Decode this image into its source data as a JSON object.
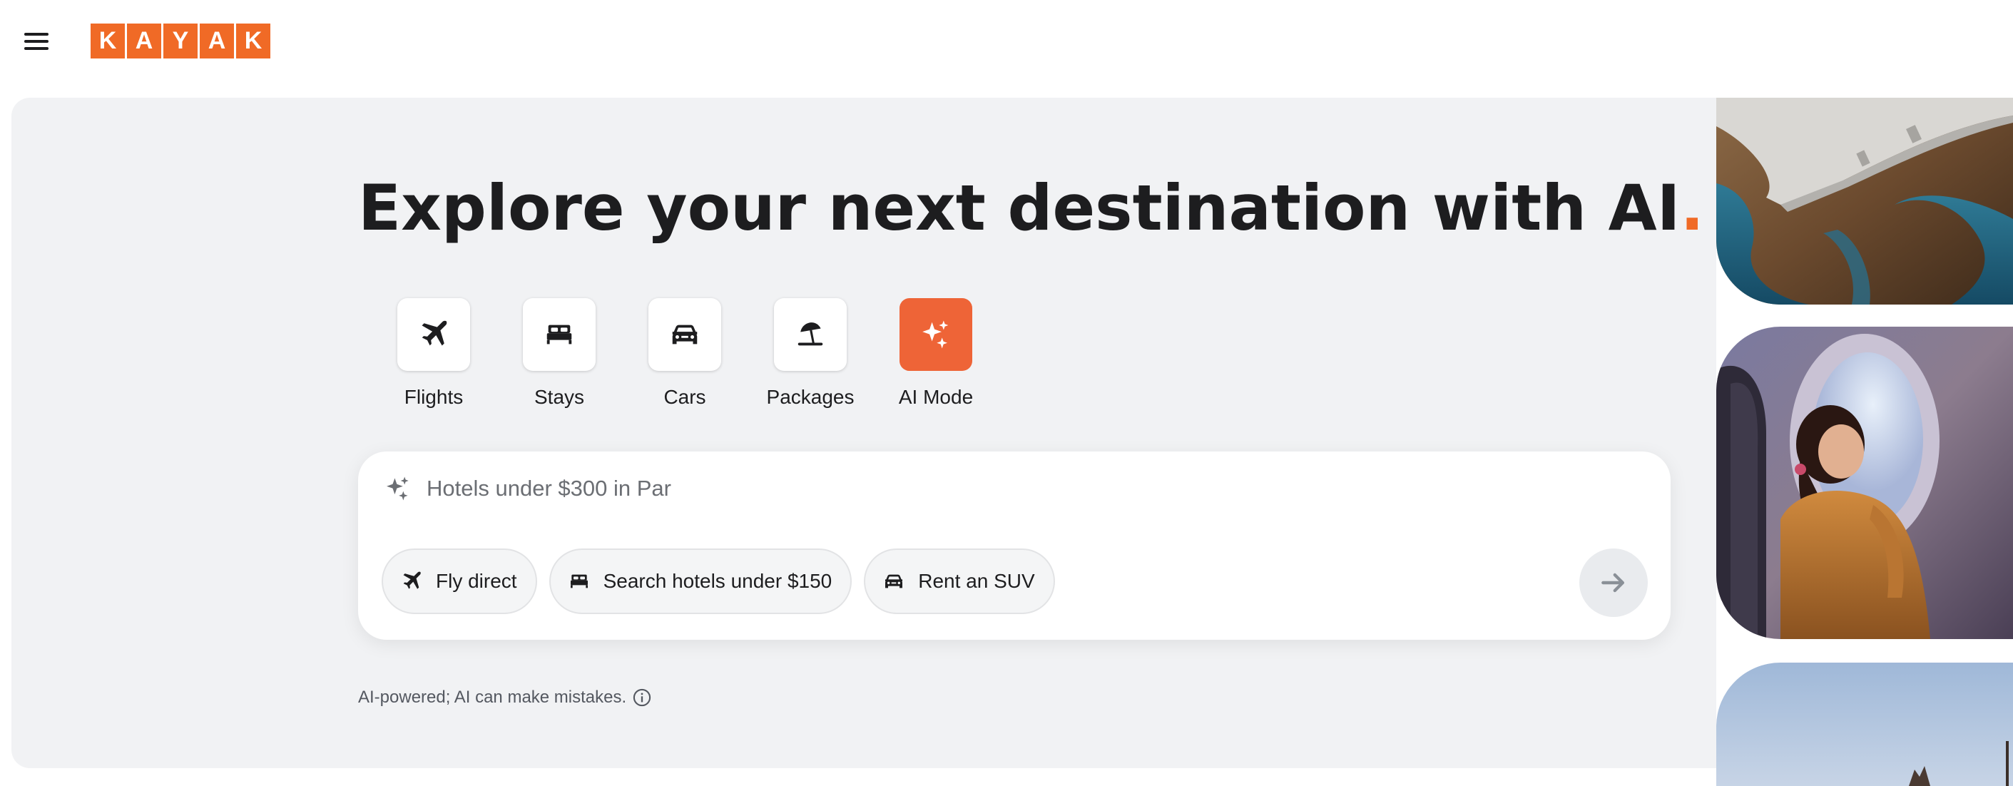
{
  "header": {
    "menu_icon": "hamburger-menu-icon",
    "logo_letters": [
      "K",
      "A",
      "Y",
      "A",
      "K"
    ],
    "brand_color": "#f06a26"
  },
  "hero": {
    "headline": "Explore your next destination with AI",
    "headline_dot": "."
  },
  "verticals": [
    {
      "label": "Flights",
      "icon": "plane-icon",
      "active": false
    },
    {
      "label": "Stays",
      "icon": "bed-icon",
      "active": false
    },
    {
      "label": "Cars",
      "icon": "car-icon",
      "active": false
    },
    {
      "label": "Packages",
      "icon": "beach-umbrella-icon",
      "active": false
    },
    {
      "label": "AI Mode",
      "icon": "sparkle-icon",
      "active": true
    }
  ],
  "search": {
    "icon": "sparkle-icon",
    "query_text": "Hotels under $300 in Par",
    "chips": [
      {
        "label": "Fly direct",
        "icon": "plane-icon"
      },
      {
        "label": "Search hotels under $150",
        "icon": "bed-icon"
      },
      {
        "label": "Rent an SUV",
        "icon": "car-icon"
      }
    ],
    "submit_icon": "arrow-right-icon"
  },
  "disclaimer": {
    "text": "AI-powered; AI can make mistakes.",
    "icon": "info-icon"
  }
}
